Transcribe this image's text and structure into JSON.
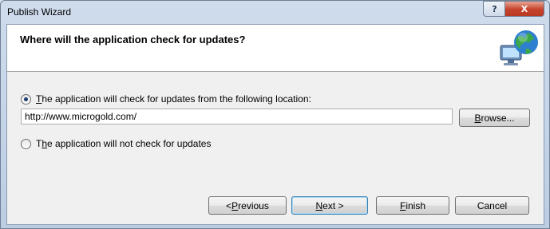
{
  "window": {
    "title": "Publish Wizard"
  },
  "caption_buttons": {
    "help": "?",
    "close": "X"
  },
  "header": {
    "title": "Where will the application check for updates?",
    "icon": "globe-computer-icon"
  },
  "options": [
    {
      "label": "The application will check for updates from the following location:",
      "mnemonic": "T",
      "checked": true
    },
    {
      "label": "The application will not check for updates",
      "mnemonic": "h",
      "checked": false
    }
  ],
  "location": {
    "value": "http://www.microgold.com/"
  },
  "buttons": {
    "browse": "Browse...",
    "previous": "< Previous",
    "next": "Next >",
    "finish": "Finish",
    "cancel": "Cancel"
  }
}
